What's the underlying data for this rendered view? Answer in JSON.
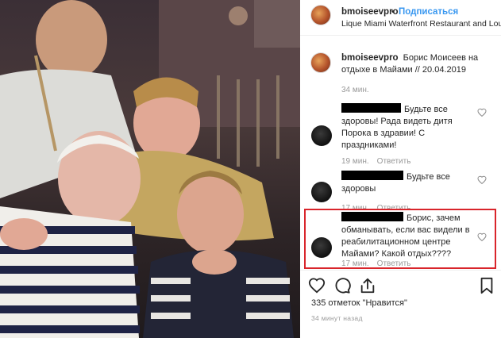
{
  "post": {
    "username": "bmoiseevpro",
    "follow_label": "Подписаться",
    "separator": "•",
    "location": "Lique Miami Waterfront Restaurant and Lounge"
  },
  "caption": {
    "username": "bmoiseevpro",
    "text": "Борис Моисеев на отдыхе в Майами // 20.04.2019",
    "time": "34 мин."
  },
  "comments": [
    {
      "text": "Будьте все здоровы! Рада видеть дитя Порока в здравии! С праздниками!",
      "time": "19 мин.",
      "reply": "Ответить"
    },
    {
      "text": "Будьте все здоровы",
      "time": "17 мин.",
      "reply": "Ответить"
    },
    {
      "text": "Борис, зачем обманывать, если вас видели в реабилитационном центре Майами? Какой отдых????",
      "time": "17 мин.",
      "reply": "Ответить"
    }
  ],
  "likes_text": "335 отметок \"Нравится\"",
  "time_ago": "34 минут назад",
  "colors": {
    "accent": "#3897f0",
    "highlight": "#d9252b"
  },
  "icons": [
    "heart-icon",
    "comment-icon",
    "share-icon",
    "bookmark-icon"
  ]
}
